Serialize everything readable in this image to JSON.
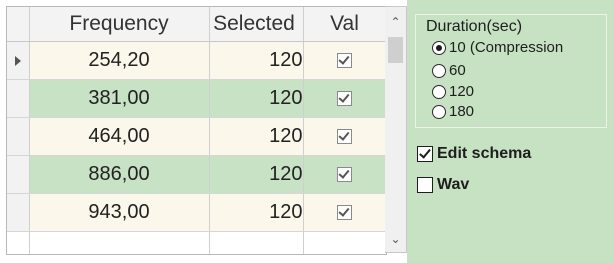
{
  "grid": {
    "columns": {
      "frequency": "Frequency",
      "selected": "Selected",
      "val": "Val"
    },
    "rows": [
      {
        "frequency": "254,20",
        "selected": "120",
        "val_checked": true,
        "current": true
      },
      {
        "frequency": "381,00",
        "selected": "120",
        "val_checked": true,
        "current": false
      },
      {
        "frequency": "464,00",
        "selected": "120",
        "val_checked": true,
        "current": false
      },
      {
        "frequency": "886,00",
        "selected": "120",
        "val_checked": true,
        "current": false
      },
      {
        "frequency": "943,00",
        "selected": "120",
        "val_checked": true,
        "current": false
      }
    ],
    "row_colors": {
      "odd": "#fbf7ea",
      "even": "#c7e2c4"
    }
  },
  "panel": {
    "background": "#c6e2c3",
    "duration_group": {
      "title": "Duration(sec)",
      "options": [
        {
          "label": "10 (Compression",
          "checked": true
        },
        {
          "label": "60",
          "checked": false
        },
        {
          "label": "120",
          "checked": false
        },
        {
          "label": "180",
          "checked": false
        }
      ]
    },
    "edit_schema": {
      "label": "Edit schema",
      "checked": true
    },
    "wav": {
      "label": "Wav",
      "checked": false
    }
  },
  "scrollbar": {
    "up_icon": "chevron-up-icon",
    "down_icon": "chevron-down-icon"
  }
}
